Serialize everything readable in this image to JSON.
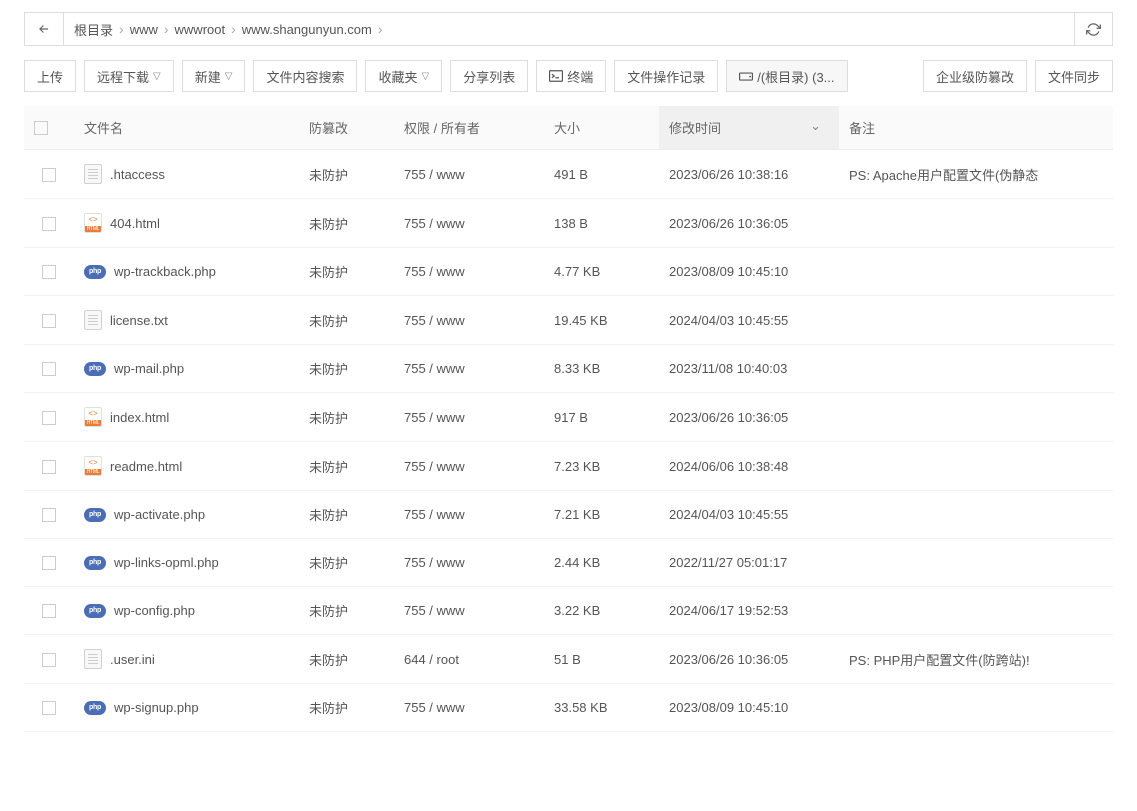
{
  "breadcrumb": [
    "根目录",
    "www",
    "wwwroot",
    "www.shangunyun.com"
  ],
  "toolbar": {
    "upload": "上传",
    "remote_dl": "远程下载",
    "new": "新建",
    "search": "文件内容搜索",
    "fav": "收藏夹",
    "share": "分享列表",
    "terminal": "终端",
    "oplog": "文件操作记录",
    "disk": "/(根目录) (3...",
    "tamper": "企业级防篡改",
    "sync": "文件同步"
  },
  "columns": {
    "name": "文件名",
    "prot": "防篡改",
    "perm": "权限 / 所有者",
    "size": "大小",
    "time": "修改时间",
    "note": "备注"
  },
  "rows": [
    {
      "icon": "txt",
      "name": ".htaccess",
      "prot": "未防护",
      "perm": "755 / www",
      "size": "491 B",
      "time": "2023/06/26 10:38:16",
      "note": "PS: Apache用户配置文件(伪静态"
    },
    {
      "icon": "html",
      "name": "404.html",
      "prot": "未防护",
      "perm": "755 / www",
      "size": "138 B",
      "time": "2023/06/26 10:36:05",
      "note": ""
    },
    {
      "icon": "php",
      "name": "wp-trackback.php",
      "prot": "未防护",
      "perm": "755 / www",
      "size": "4.77 KB",
      "time": "2023/08/09 10:45:10",
      "note": ""
    },
    {
      "icon": "txt",
      "name": "license.txt",
      "prot": "未防护",
      "perm": "755 / www",
      "size": "19.45 KB",
      "time": "2024/04/03 10:45:55",
      "note": ""
    },
    {
      "icon": "php",
      "name": "wp-mail.php",
      "prot": "未防护",
      "perm": "755 / www",
      "size": "8.33 KB",
      "time": "2023/11/08 10:40:03",
      "note": ""
    },
    {
      "icon": "html",
      "name": "index.html",
      "prot": "未防护",
      "perm": "755 / www",
      "size": "917 B",
      "time": "2023/06/26 10:36:05",
      "note": ""
    },
    {
      "icon": "html",
      "name": "readme.html",
      "prot": "未防护",
      "perm": "755 / www",
      "size": "7.23 KB",
      "time": "2024/06/06 10:38:48",
      "note": ""
    },
    {
      "icon": "php",
      "name": "wp-activate.php",
      "prot": "未防护",
      "perm": "755 / www",
      "size": "7.21 KB",
      "time": "2024/04/03 10:45:55",
      "note": ""
    },
    {
      "icon": "php",
      "name": "wp-links-opml.php",
      "prot": "未防护",
      "perm": "755 / www",
      "size": "2.44 KB",
      "time": "2022/11/27 05:01:17",
      "note": ""
    },
    {
      "icon": "php",
      "name": "wp-config.php",
      "prot": "未防护",
      "perm": "755 / www",
      "size": "3.22 KB",
      "time": "2024/06/17 19:52:53",
      "note": ""
    },
    {
      "icon": "txt",
      "name": ".user.ini",
      "prot": "未防护",
      "perm": "644 / root",
      "size": "51 B",
      "time": "2023/06/26 10:36:05",
      "note": "PS: PHP用户配置文件(防跨站)!"
    },
    {
      "icon": "php",
      "name": "wp-signup.php",
      "prot": "未防护",
      "perm": "755 / www",
      "size": "33.58 KB",
      "time": "2023/08/09 10:45:10",
      "note": ""
    }
  ]
}
